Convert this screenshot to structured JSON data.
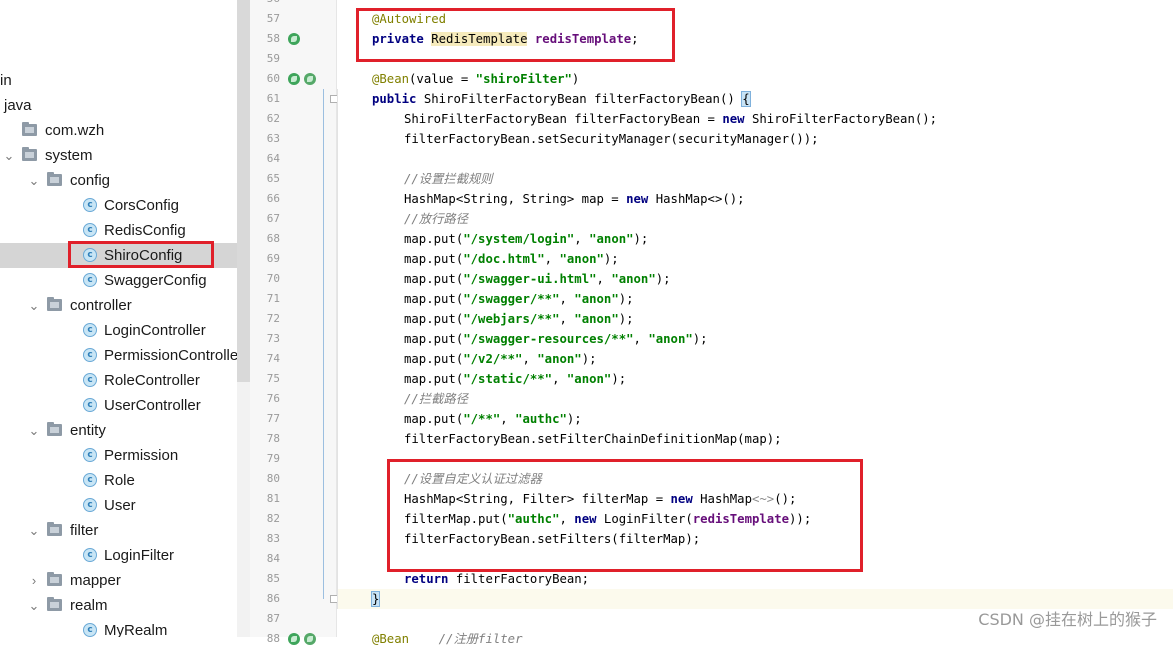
{
  "tree": {
    "items": [
      {
        "label": "in",
        "type": "folder-partial",
        "depth": 0,
        "arrow": ""
      },
      {
        "label": "java",
        "type": "folder-partial",
        "depth": 0,
        "arrow": ""
      },
      {
        "label": "com.wzh",
        "type": "package",
        "depth": 1,
        "arrow": ""
      },
      {
        "label": "system",
        "type": "package",
        "depth": 1,
        "arrow": "expanded"
      },
      {
        "label": "config",
        "type": "package",
        "depth": 2,
        "arrow": "expanded"
      },
      {
        "label": "CorsConfig",
        "type": "class",
        "depth": 3,
        "arrow": ""
      },
      {
        "label": "RedisConfig",
        "type": "class",
        "depth": 3,
        "arrow": ""
      },
      {
        "label": "ShiroConfig",
        "type": "class",
        "depth": 3,
        "arrow": "",
        "selected": true
      },
      {
        "label": "SwaggerConfig",
        "type": "class",
        "depth": 3,
        "arrow": ""
      },
      {
        "label": "controller",
        "type": "package",
        "depth": 2,
        "arrow": "expanded"
      },
      {
        "label": "LoginController",
        "type": "class",
        "depth": 3,
        "arrow": ""
      },
      {
        "label": "PermissionControlle",
        "type": "class",
        "depth": 3,
        "arrow": ""
      },
      {
        "label": "RoleController",
        "type": "class",
        "depth": 3,
        "arrow": ""
      },
      {
        "label": "UserController",
        "type": "class",
        "depth": 3,
        "arrow": ""
      },
      {
        "label": "entity",
        "type": "package",
        "depth": 2,
        "arrow": "expanded"
      },
      {
        "label": "Permission",
        "type": "class",
        "depth": 3,
        "arrow": ""
      },
      {
        "label": "Role",
        "type": "class",
        "depth": 3,
        "arrow": ""
      },
      {
        "label": "User",
        "type": "class",
        "depth": 3,
        "arrow": ""
      },
      {
        "label": "filter",
        "type": "package",
        "depth": 2,
        "arrow": "expanded"
      },
      {
        "label": "LoginFilter",
        "type": "class",
        "depth": 3,
        "arrow": ""
      },
      {
        "label": "mapper",
        "type": "package",
        "depth": 2,
        "arrow": "collapsed"
      },
      {
        "label": "realm",
        "type": "package",
        "depth": 2,
        "arrow": "expanded"
      },
      {
        "label": "MyRealm",
        "type": "class",
        "depth": 3,
        "arrow": ""
      }
    ],
    "class_icon_letter": "c",
    "arrow_expanded": "⌄",
    "arrow_collapsed": "›"
  },
  "editor": {
    "current_line": 86,
    "lines": [
      {
        "n": "56",
        "indent": 0,
        "tokens": []
      },
      {
        "n": "57",
        "indent": 1,
        "tokens": [
          {
            "c": "ann",
            "t": "@Autowired"
          }
        ]
      },
      {
        "n": "58",
        "indent": 1,
        "gutter": [
          "spring"
        ],
        "tokens": [
          {
            "c": "kw",
            "t": "private "
          },
          {
            "c": "hl-type",
            "t": "RedisTemplate"
          },
          {
            "c": "",
            "t": " "
          },
          {
            "c": "fld",
            "t": "redisTemplate"
          },
          {
            "c": "",
            "t": ";"
          }
        ]
      },
      {
        "n": "59",
        "indent": 0,
        "tokens": []
      },
      {
        "n": "60",
        "indent": 1,
        "gutter": [
          "spring",
          "bean"
        ],
        "tokens": [
          {
            "c": "ann",
            "t": "@Bean"
          },
          {
            "c": "",
            "t": "(value = "
          },
          {
            "c": "str",
            "t": "\"shiroFilter\""
          },
          {
            "c": "",
            "t": ")"
          }
        ]
      },
      {
        "n": "61",
        "indent": 1,
        "fold": true,
        "tokens": [
          {
            "c": "kw",
            "t": "public "
          },
          {
            "c": "",
            "t": "ShiroFilterFactoryBean filterFactoryBean() "
          },
          {
            "c": "brace-hl",
            "t": "{"
          }
        ]
      },
      {
        "n": "62",
        "indent": 2,
        "tokens": [
          {
            "c": "",
            "t": "ShiroFilterFactoryBean filterFactoryBean = "
          },
          {
            "c": "kw",
            "t": "new "
          },
          {
            "c": "",
            "t": "ShiroFilterFactoryBean();"
          }
        ]
      },
      {
        "n": "63",
        "indent": 2,
        "tokens": [
          {
            "c": "",
            "t": "filterFactoryBean.setSecurityManager(securityManager());"
          }
        ]
      },
      {
        "n": "64",
        "indent": 0,
        "tokens": []
      },
      {
        "n": "65",
        "indent": 2,
        "tokens": [
          {
            "c": "cmt",
            "t": "//设置拦截规则"
          }
        ]
      },
      {
        "n": "66",
        "indent": 2,
        "tokens": [
          {
            "c": "",
            "t": "HashMap<String, String> map = "
          },
          {
            "c": "kw",
            "t": "new "
          },
          {
            "c": "",
            "t": "HashMap<>();"
          }
        ]
      },
      {
        "n": "67",
        "indent": 2,
        "tokens": [
          {
            "c": "cmt",
            "t": "//放行路径"
          }
        ]
      },
      {
        "n": "68",
        "indent": 2,
        "tokens": [
          {
            "c": "",
            "t": "map.put("
          },
          {
            "c": "str",
            "t": "\"/system/login\""
          },
          {
            "c": "",
            "t": ", "
          },
          {
            "c": "str",
            "t": "\"anon\""
          },
          {
            "c": "",
            "t": ");"
          }
        ]
      },
      {
        "n": "69",
        "indent": 2,
        "tokens": [
          {
            "c": "",
            "t": "map.put("
          },
          {
            "c": "str",
            "t": "\"/doc.html\""
          },
          {
            "c": "",
            "t": ", "
          },
          {
            "c": "str",
            "t": "\"anon\""
          },
          {
            "c": "",
            "t": ");"
          }
        ]
      },
      {
        "n": "70",
        "indent": 2,
        "tokens": [
          {
            "c": "",
            "t": "map.put("
          },
          {
            "c": "str",
            "t": "\"/swagger-ui.html\""
          },
          {
            "c": "",
            "t": ", "
          },
          {
            "c": "str",
            "t": "\"anon\""
          },
          {
            "c": "",
            "t": ");"
          }
        ]
      },
      {
        "n": "71",
        "indent": 2,
        "tokens": [
          {
            "c": "",
            "t": "map.put("
          },
          {
            "c": "str",
            "t": "\"/swagger/**\""
          },
          {
            "c": "",
            "t": ", "
          },
          {
            "c": "str",
            "t": "\"anon\""
          },
          {
            "c": "",
            "t": ");"
          }
        ]
      },
      {
        "n": "72",
        "indent": 2,
        "tokens": [
          {
            "c": "",
            "t": "map.put("
          },
          {
            "c": "str",
            "t": "\"/webjars/**\""
          },
          {
            "c": "",
            "t": ", "
          },
          {
            "c": "str",
            "t": "\"anon\""
          },
          {
            "c": "",
            "t": ");"
          }
        ]
      },
      {
        "n": "73",
        "indent": 2,
        "tokens": [
          {
            "c": "",
            "t": "map.put("
          },
          {
            "c": "str",
            "t": "\"/swagger-resources/**\""
          },
          {
            "c": "",
            "t": ", "
          },
          {
            "c": "str",
            "t": "\"anon\""
          },
          {
            "c": "",
            "t": ");"
          }
        ]
      },
      {
        "n": "74",
        "indent": 2,
        "tokens": [
          {
            "c": "",
            "t": "map.put("
          },
          {
            "c": "str",
            "t": "\"/v2/**\""
          },
          {
            "c": "",
            "t": ", "
          },
          {
            "c": "str",
            "t": "\"anon\""
          },
          {
            "c": "",
            "t": ");"
          }
        ]
      },
      {
        "n": "75",
        "indent": 2,
        "tokens": [
          {
            "c": "",
            "t": "map.put("
          },
          {
            "c": "str",
            "t": "\"/static/**\""
          },
          {
            "c": "",
            "t": ", "
          },
          {
            "c": "str",
            "t": "\"anon\""
          },
          {
            "c": "",
            "t": ");"
          }
        ]
      },
      {
        "n": "76",
        "indent": 2,
        "tokens": [
          {
            "c": "cmt",
            "t": "//拦截路径"
          }
        ]
      },
      {
        "n": "77",
        "indent": 2,
        "tokens": [
          {
            "c": "",
            "t": "map.put("
          },
          {
            "c": "str",
            "t": "\"/**\""
          },
          {
            "c": "",
            "t": ", "
          },
          {
            "c": "str",
            "t": "\"authc\""
          },
          {
            "c": "",
            "t": ");"
          }
        ]
      },
      {
        "n": "78",
        "indent": 2,
        "tokens": [
          {
            "c": "",
            "t": "filterFactoryBean.setFilterChainDefinitionMap(map);"
          }
        ]
      },
      {
        "n": "79",
        "indent": 0,
        "tokens": []
      },
      {
        "n": "80",
        "indent": 2,
        "tokens": [
          {
            "c": "cmt",
            "t": "//设置自定义认证过滤器"
          }
        ]
      },
      {
        "n": "81",
        "indent": 2,
        "tokens": [
          {
            "c": "",
            "t": "HashMap<String, Filter> filterMap = "
          },
          {
            "c": "kw",
            "t": "new "
          },
          {
            "c": "",
            "t": "HashMap"
          },
          {
            "c": "dim",
            "t": "<~>"
          },
          {
            "c": "",
            "t": "();"
          }
        ]
      },
      {
        "n": "82",
        "indent": 2,
        "tokens": [
          {
            "c": "",
            "t": "filterMap.put("
          },
          {
            "c": "str",
            "t": "\"authc\""
          },
          {
            "c": "",
            "t": ", "
          },
          {
            "c": "kw",
            "t": "new "
          },
          {
            "c": "",
            "t": "LoginFilter("
          },
          {
            "c": "fld",
            "t": "redisTemplate"
          },
          {
            "c": "",
            "t": "));"
          }
        ]
      },
      {
        "n": "83",
        "indent": 2,
        "tokens": [
          {
            "c": "",
            "t": "filterFactoryBean.setFilters(filterMap);"
          }
        ]
      },
      {
        "n": "84",
        "indent": 0,
        "tokens": []
      },
      {
        "n": "85",
        "indent": 2,
        "tokens": [
          {
            "c": "kw",
            "t": "return "
          },
          {
            "c": "",
            "t": "filterFactoryBean;"
          }
        ]
      },
      {
        "n": "86",
        "indent": 1,
        "fold": true,
        "tokens": [
          {
            "c": "brace-hl",
            "t": "}"
          }
        ]
      },
      {
        "n": "87",
        "indent": 0,
        "tokens": []
      },
      {
        "n": "88",
        "indent": 1,
        "gutter": [
          "spring",
          "bean"
        ],
        "tokens": [
          {
            "c": "ann",
            "t": "@Bean"
          },
          {
            "c": "",
            "t": "    "
          },
          {
            "c": "cmt",
            "t": "//注册filter"
          }
        ]
      }
    ]
  },
  "watermark": "CSDN @挂在树上的猴子"
}
